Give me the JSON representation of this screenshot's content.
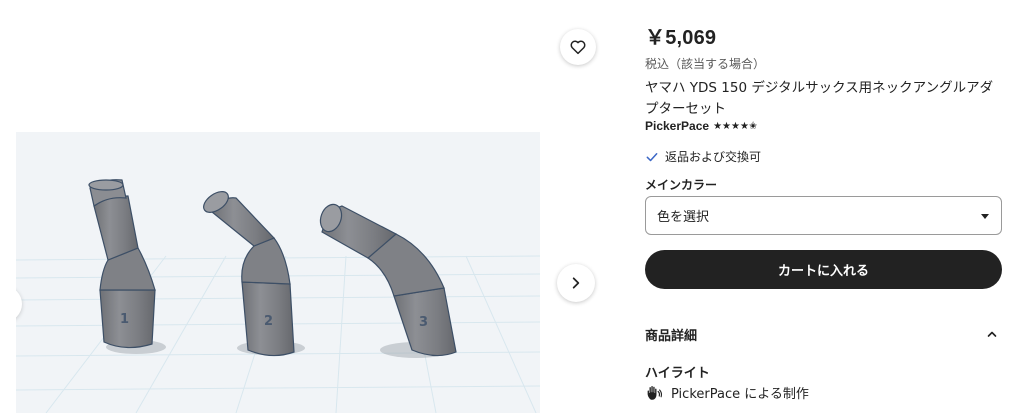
{
  "product": {
    "price": "￥5,069",
    "tax_note": "税込（該当する場合）",
    "title": "ヤマハ YDS 150 デジタルサックス用ネックアングルアダプターセット",
    "shop_name": "PickerPace",
    "rating_stars": "★★★★✬",
    "returns_text": "返品および交換可"
  },
  "variant": {
    "label": "メインカラー",
    "selected": "色を選択"
  },
  "actions": {
    "add_to_cart": "カートに入れる"
  },
  "details": {
    "section_title": "商品詳細",
    "highlights_title": "ハイライト",
    "maker_text": "PickerPace による制作"
  },
  "image": {
    "part_labels": [
      "1",
      "2",
      "3"
    ]
  },
  "icons": {
    "favorite": "heart-icon",
    "next": "chevron-right-icon",
    "returns": "check-icon",
    "dropdown": "caret-down-icon",
    "collapse": "chevron-up-icon",
    "maker": "hand-icon"
  },
  "colors": {
    "cart_button": "#222222",
    "check": "#3b67c6",
    "part_gray": "#7d7f84"
  }
}
